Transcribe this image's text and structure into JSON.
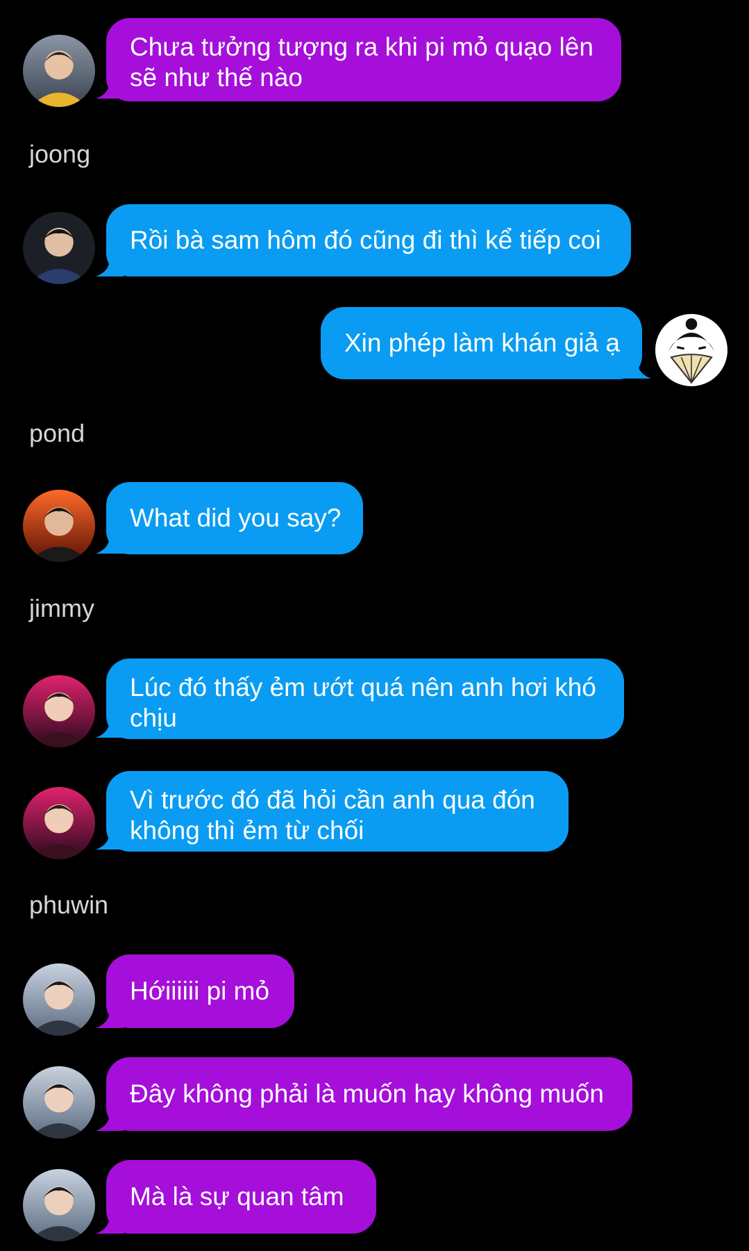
{
  "colors": {
    "background": "#000000",
    "purple_bubble": "#a50fd9",
    "blue_bubble": "#0a9cf2",
    "sender_name": "#d7d7d7"
  },
  "messages": [
    {
      "line1": "Chưa tưởng tượng ra khi pi mỏ quạo lên",
      "line2": "sẽ như thế nào"
    },
    {
      "text": "Rồi bà sam hôm đó cũng đi thì kể tiếp coi"
    },
    {
      "text": "Xin phép làm khán giả ạ"
    },
    {
      "text": "What did you say?"
    },
    {
      "line1": "Lúc đó thấy ẻm ướt quá nên anh hơi khó",
      "line2": "chịu"
    },
    {
      "line1": "Vì trước đó đã hỏi cần anh qua đón",
      "line2": "không thì ẻm từ chối"
    },
    {
      "text": "Hớiiiiii pi mỏ"
    },
    {
      "text": "Đây không phải là muốn hay không muốn"
    },
    {
      "text": "Mà là sự quan tâm"
    }
  ],
  "names": {
    "joong": "joong",
    "pond": "pond",
    "jimmy": "jimmy",
    "phuwin": "phuwin"
  }
}
